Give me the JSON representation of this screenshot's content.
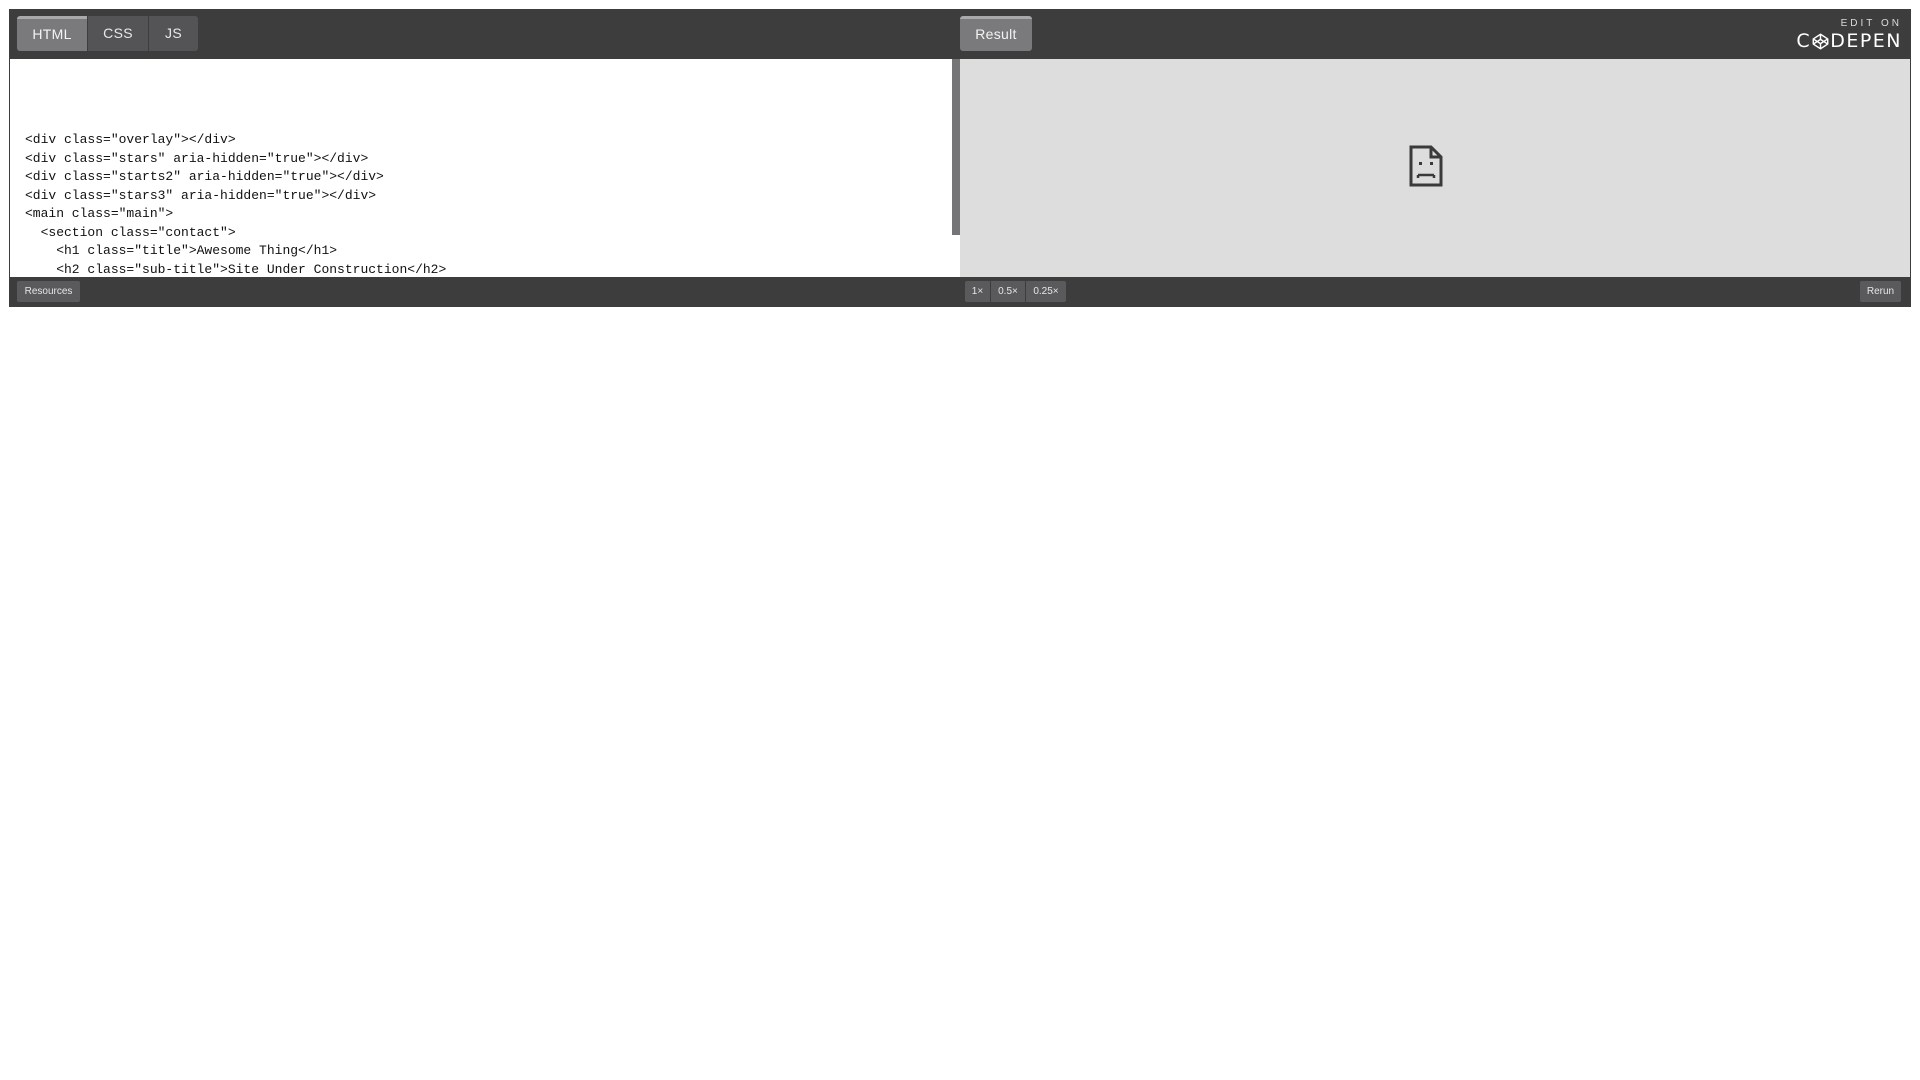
{
  "tabs": {
    "html": "HTML",
    "css": "CSS",
    "js": "JS",
    "result": "Result"
  },
  "branding": {
    "edit_on": "EDIT ON",
    "wordmark_prefix": "C",
    "wordmark_suffix": "DEPEN"
  },
  "code": {
    "lines": [
      "<div class=\"overlay\"></div>",
      "<div class=\"stars\" aria-hidden=\"true\"></div>",
      "<div class=\"starts2\" aria-hidden=\"true\"></div>",
      "<div class=\"stars3\" aria-hidden=\"true\"></div>",
      "<main class=\"main\">",
      "  <section class=\"contact\">",
      "    <h1 class=\"title\">Awesome Thing</h1>",
      "    <h2 class=\"sub-title\">Site Under Construction</h2>"
    ]
  },
  "result": {
    "icon": "broken-page-icon"
  },
  "footer": {
    "resources": "Resources",
    "zoom_1": "1×",
    "zoom_05": "0.5×",
    "zoom_025": "0.25×",
    "rerun": "Rerun"
  },
  "colors": {
    "bar_background": "#3d3d3e",
    "result_background": "#dddddd",
    "active_tab": "#7a7a7c"
  }
}
